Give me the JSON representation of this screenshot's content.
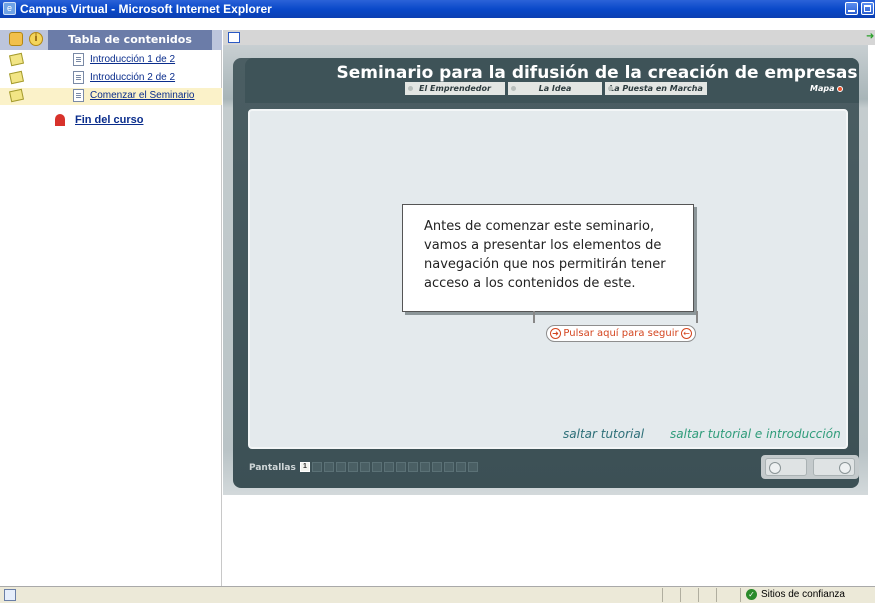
{
  "window": {
    "title": "Campus Virtual - Microsoft Internet Explorer"
  },
  "toc": {
    "header_label": "Tabla de contenidos",
    "items": [
      {
        "label": "Introducción 1 de 2",
        "active": false
      },
      {
        "label": "Introducción 2 de 2",
        "active": false
      },
      {
        "label": "Comenzar el Seminario",
        "active": true
      }
    ],
    "end_label": "Fin del curso"
  },
  "seminar": {
    "title": "Seminario para la difusión de la creación de empresas",
    "nav": [
      "El Emprendedor",
      "La Idea",
      "La Puesta en Marcha"
    ],
    "map_label": "Mapa",
    "message": "Antes de comenzar este seminario, vamos a presentar los elementos de navegación que nos permitirán tener acceso a los contenidos de este.",
    "continue_label": "Pulsar aquí para seguir",
    "skip_tutorial": "saltar tutorial",
    "skip_all": "saltar tutorial e introducción",
    "screens_label": "Pantallas",
    "current_screen": "1",
    "total_screens": 15
  },
  "statusbar": {
    "zone": "Sitios de confianza"
  },
  "colors": {
    "titlebar": "#0a49c9",
    "toc_header": "#6b7ca8",
    "frame": "#3e5358",
    "accent_orange": "#d4451f",
    "link_blue": "#0a2d8c"
  }
}
